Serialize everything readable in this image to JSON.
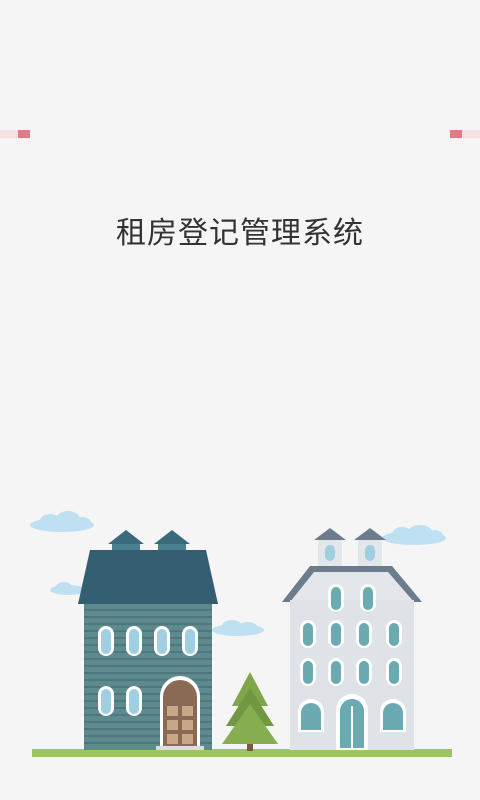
{
  "app": {
    "title": "租房登记管理系统"
  },
  "theme": {
    "background": "#f5f5f5",
    "accent": "#e57a86",
    "title_color": "#333333"
  },
  "illustration": {
    "icons": [
      "cloud-icon",
      "house-icon",
      "tree-icon",
      "grass-icon"
    ]
  }
}
